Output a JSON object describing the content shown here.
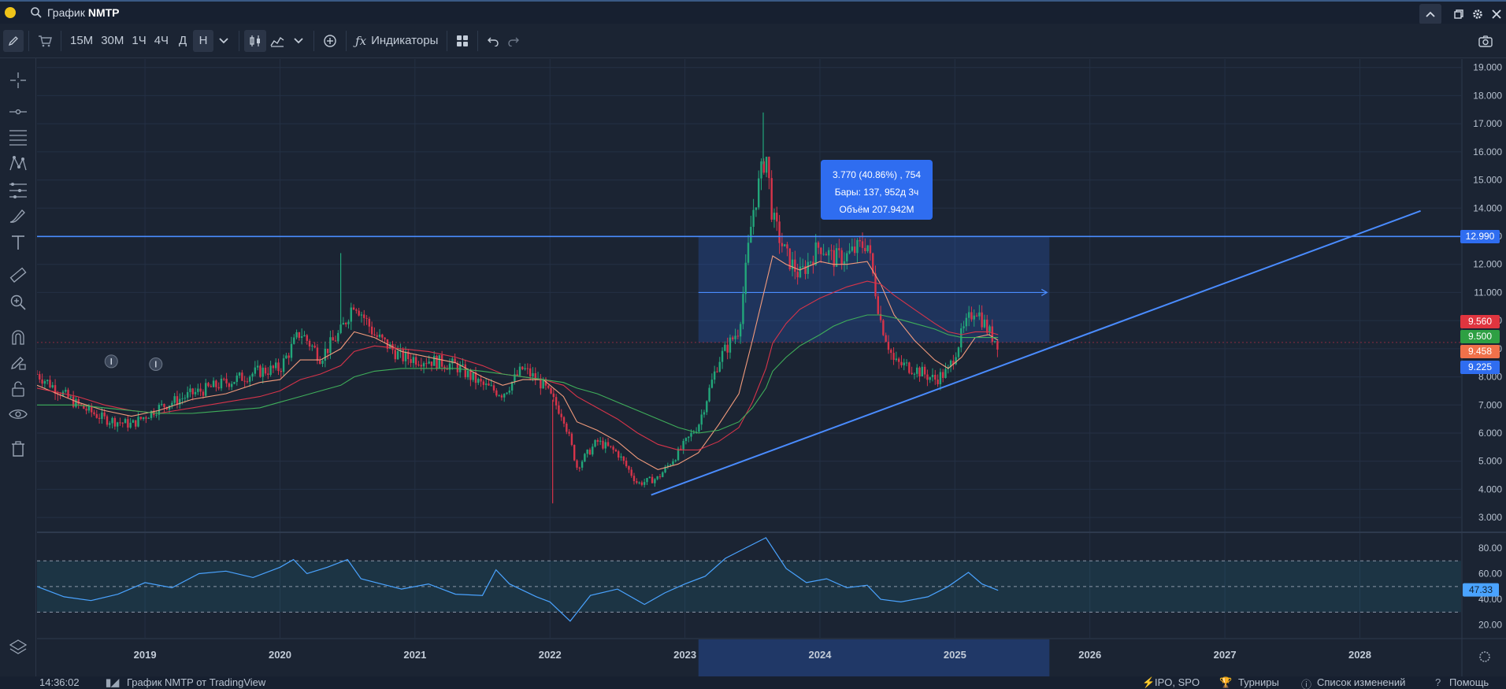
{
  "window": {
    "title_prefix": "График",
    "ticker": "NMTP"
  },
  "toolbar": {
    "timeframes": [
      "15М",
      "30М",
      "1Ч",
      "4Ч",
      "Д",
      "Н"
    ],
    "active_timeframe": "Н",
    "indicators_label": "Индикаторы"
  },
  "chart_data": [
    {
      "type": "line",
      "title": "",
      "subtitle": "",
      "y_ticks": [
        "19.000",
        "18.000",
        "17.000",
        "16.000",
        "15.000",
        "14.000",
        "13.000",
        "12.000",
        "11.000",
        "10.000",
        "9.000",
        "8.000",
        "7.000",
        "6.000",
        "5.000",
        "4.000",
        "3.000"
      ],
      "x_ticks": [
        "2019",
        "2020",
        "2021",
        "2022",
        "2023",
        "2024",
        "2025",
        "2026",
        "2027",
        "2028"
      ],
      "ylim": [
        2.5,
        19.3
      ],
      "xlim": [
        2018.2,
        2028.75
      ],
      "x": [
        2018.2,
        2018.5,
        2018.7,
        2018.9,
        2019.1,
        2019.35,
        2019.6,
        2019.85,
        2020.0,
        2020.15,
        2020.3,
        2020.45,
        2020.55,
        2020.7,
        2020.9,
        2021.1,
        2021.3,
        2021.5,
        2021.65,
        2021.8,
        2021.95,
        2022.1,
        2022.2,
        2022.35,
        2022.5,
        2022.65,
        2022.8,
        2022.95,
        2023.1,
        2023.25,
        2023.4,
        2023.5,
        2023.6,
        2023.65,
        2023.75,
        2023.85,
        2024.0,
        2024.1,
        2024.2,
        2024.35,
        2024.45,
        2024.55,
        2024.7,
        2024.85,
        2024.95,
        2025.05,
        2025.15,
        2025.25,
        2025.32
      ],
      "series": [
        {
          "values": [
            8.1,
            7.0,
            6.5,
            6.3,
            6.9,
            7.4,
            7.8,
            8.2,
            8.3,
            9.6,
            8.7,
            9.6,
            10.7,
            9.5,
            8.7,
            8.6,
            8.4,
            7.7,
            7.4,
            8.3,
            7.7,
            6.6,
            4.8,
            5.7,
            5.3,
            4.2,
            4.4,
            5.3,
            6.3,
            8.6,
            9.7,
            13.8,
            16.0,
            13.6,
            12.3,
            11.6,
            12.7,
            12.2,
            12.3,
            12.8,
            10.0,
            8.5,
            8.3,
            7.9,
            8.2,
            9.5,
            10.5,
            9.6,
            9.2
          ]
        },
        {
          "values": [
            7.7,
            7.1,
            6.8,
            6.6,
            6.8,
            7.2,
            7.4,
            7.8,
            7.9,
            8.6,
            8.6,
            9.0,
            9.6,
            9.4,
            8.9,
            8.7,
            8.5,
            8.0,
            7.7,
            7.9,
            7.9,
            7.3,
            6.4,
            6.1,
            5.7,
            5.1,
            4.7,
            4.9,
            5.3,
            6.3,
            7.4,
            9.3,
            11.3,
            12.3,
            12.0,
            11.8,
            12.1,
            12.0,
            12.0,
            12.1,
            11.3,
            10.2,
            9.3,
            8.6,
            8.3,
            8.7,
            9.4,
            9.5,
            9.3
          ]
        },
        {
          "values": [
            7.6,
            7.3,
            7.0,
            6.8,
            6.7,
            6.9,
            7.1,
            7.3,
            7.5,
            7.9,
            8.1,
            8.4,
            8.9,
            9.1,
            9.0,
            8.9,
            8.7,
            8.4,
            8.1,
            8.0,
            7.9,
            7.7,
            7.3,
            6.9,
            6.5,
            6.0,
            5.6,
            5.4,
            5.4,
            5.7,
            6.2,
            7.1,
            8.3,
            9.2,
            9.9,
            10.4,
            10.8,
            11.0,
            11.2,
            11.4,
            11.3,
            10.9,
            10.4,
            9.9,
            9.6,
            9.5,
            9.6,
            9.6,
            9.5
          ]
        },
        {
          "values": [
            7.0,
            7.0,
            6.9,
            6.8,
            6.7,
            6.7,
            6.8,
            6.9,
            7.1,
            7.3,
            7.5,
            7.7,
            8.0,
            8.2,
            8.3,
            8.3,
            8.3,
            8.2,
            8.1,
            8.0,
            7.9,
            7.8,
            7.6,
            7.4,
            7.1,
            6.8,
            6.5,
            6.2,
            6.0,
            6.1,
            6.4,
            6.9,
            7.6,
            8.2,
            8.7,
            9.1,
            9.5,
            9.8,
            10.0,
            10.2,
            10.2,
            10.1,
            9.9,
            9.7,
            9.5,
            9.4,
            9.4,
            9.4,
            9.4
          ]
        }
      ],
      "price_tags": [
        {
          "value": "12.990",
          "color": "#2f6df0"
        },
        {
          "value": "9.560",
          "color": "#e0353f"
        },
        {
          "value": "9.500",
          "color": "#2ea043"
        },
        {
          "value": "9.458",
          "color": "#f0714a"
        },
        {
          "value": "9.225",
          "color": "#2f6df0"
        }
      ],
      "horizontal_line": 12.99,
      "trendline": [
        [
          2022.75,
          3.8
        ],
        [
          2028.45,
          13.9
        ]
      ],
      "measure_box": {
        "x": [
          2023.1,
          2025.7
        ],
        "y": [
          9.225,
          12.99
        ],
        "mid": 11.0
      },
      "tooltip": {
        "line1": "3.770 (40.86%) , 754",
        "line2": "Бары: 137, 952д 3ч",
        "line3": "Объём 207.942M"
      }
    },
    {
      "type": "line",
      "title": "",
      "y_ticks": [
        "80.00",
        "60.00",
        "40.00",
        "20.00"
      ],
      "ylim": [
        10,
        91
      ],
      "band": [
        30,
        70
      ],
      "midline": 50,
      "last_value": "47.33",
      "x": [
        2018.2,
        2018.4,
        2018.6,
        2018.8,
        2019.0,
        2019.2,
        2019.4,
        2019.6,
        2019.8,
        2020.0,
        2020.1,
        2020.2,
        2020.35,
        2020.5,
        2020.6,
        2020.75,
        2020.9,
        2021.1,
        2021.3,
        2021.5,
        2021.6,
        2021.7,
        2021.9,
        2022.0,
        2022.15,
        2022.3,
        2022.5,
        2022.7,
        2022.85,
        2023.0,
        2023.15,
        2023.3,
        2023.45,
        2023.6,
        2023.75,
        2023.9,
        2024.05,
        2024.2,
        2024.35,
        2024.45,
        2024.6,
        2024.8,
        2024.95,
        2025.1,
        2025.2,
        2025.32
      ],
      "series": [
        {
          "values": [
            50,
            42,
            39,
            44,
            53,
            49,
            60,
            62,
            57,
            65,
            71,
            60,
            65,
            71,
            56,
            52,
            48,
            52,
            44,
            43,
            63,
            52,
            42,
            38,
            23,
            43,
            48,
            36,
            45,
            52,
            58,
            72,
            80,
            88,
            64,
            53,
            56,
            49,
            51,
            40,
            38,
            42,
            50,
            61,
            52,
            47
          ]
        }
      ]
    }
  ],
  "status": {
    "time": "14:36:02",
    "chart_link": "График NMTP от TradingView",
    "ipo": "IPO, SPO",
    "tournaments": "Турниры",
    "changes": "Список изменений",
    "help": "Помощь"
  },
  "colors": {
    "background": "#1b2433",
    "grid": "#243044",
    "candles_up": "#22a67a",
    "candles_down": "#d6344a",
    "accent": "#2f6df0",
    "rsi": "#4aa3ff"
  }
}
